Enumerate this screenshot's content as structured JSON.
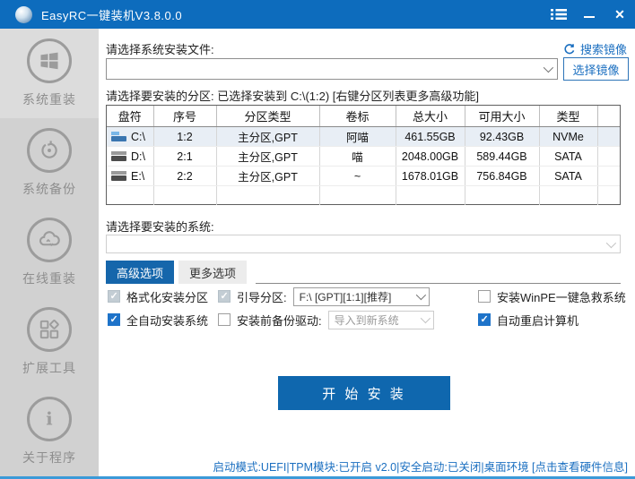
{
  "window": {
    "title": "EasyRC一键装机V3.8.0.0"
  },
  "titlebar": {
    "icons": {
      "menu": "list-icon",
      "minimize": "minimize-icon",
      "close": "close-icon"
    },
    "close_glyph": "✕"
  },
  "sidebar": {
    "items": [
      {
        "label": "系统重装",
        "icon": "windows-logo-icon",
        "active": true
      },
      {
        "label": "系统备份",
        "icon": "restore-icon",
        "active": false
      },
      {
        "label": "在线重装",
        "icon": "cloud-icon",
        "active": false
      },
      {
        "label": "扩展工具",
        "icon": "apps-grid-icon",
        "active": false
      },
      {
        "label": "关于程序",
        "icon": "info-icon",
        "active": false
      }
    ]
  },
  "main": {
    "file_section": {
      "label": "请选择系统安装文件:",
      "search_link": "搜索镜像",
      "combo_value": "",
      "select_button": "选择镜像"
    },
    "partition_section": {
      "label": "请选择要安装的分区: 已选择安装到 C:\\(1:2) [右键分区列表更多高级功能]",
      "table": {
        "headers": [
          "盘符",
          "序号",
          "分区类型",
          "卷标",
          "总大小",
          "可用大小",
          "类型",
          ""
        ],
        "rows": [
          [
            "C:\\",
            "1:2",
            "主分区,GPT",
            "阿喵",
            "461.55GB",
            "92.43GB",
            "NVMe"
          ],
          [
            "D:\\",
            "2:1",
            "主分区,GPT",
            "喵",
            "2048.00GB",
            "589.44GB",
            "SATA"
          ],
          [
            "E:\\",
            "2:2",
            "主分区,GPT",
            "~",
            "1678.01GB",
            "756.84GB",
            "SATA"
          ]
        ],
        "selected_row": 0
      }
    },
    "system_section": {
      "label": "请选择要安装的系统:",
      "combo_value": ""
    },
    "tabs": [
      {
        "label": "高级选项",
        "active": true
      },
      {
        "label": "更多选项",
        "active": false
      }
    ],
    "options": {
      "format_partition": {
        "label": "格式化安装分区",
        "checked": true,
        "disabled": true
      },
      "boot_partition": {
        "label": "引导分区:",
        "checked": true,
        "disabled": true,
        "value": "F:\\ [GPT][1:1][推荐]"
      },
      "install_winpe": {
        "label": "安装WinPE一键急救系统",
        "checked": false,
        "disabled": false
      },
      "auto_install": {
        "label": "全自动安装系统",
        "checked": true,
        "disabled": false
      },
      "backup_drivers": {
        "label": "安装前备份驱动:",
        "checked": false,
        "disabled": false,
        "value": "导入到新系统",
        "value_disabled": true
      },
      "auto_restart": {
        "label": "自动重启计算机",
        "checked": true,
        "disabled": false
      }
    },
    "start_button": "开 始 安 装",
    "statusbar": "启动模式:UEFI|TPM模块:已开启 v2.0|安全启动:已关闭|桌面环境 [点击查看硬件信息]"
  },
  "colors": {
    "titlebar": "#0d6cbd",
    "accent_blue": "#1b6fc0",
    "start_button": "#0f67ae",
    "tab_active": "#1566ab",
    "checkbox_checked": "#1e73c9",
    "checkbox_disabled": "#c3cdd4",
    "sidebar_bg": "#d1d1d1",
    "sidebar_active_bg": "#dcdcdc",
    "row_selected": "#e8eef5",
    "bottom_line": "#3b9ad8"
  }
}
